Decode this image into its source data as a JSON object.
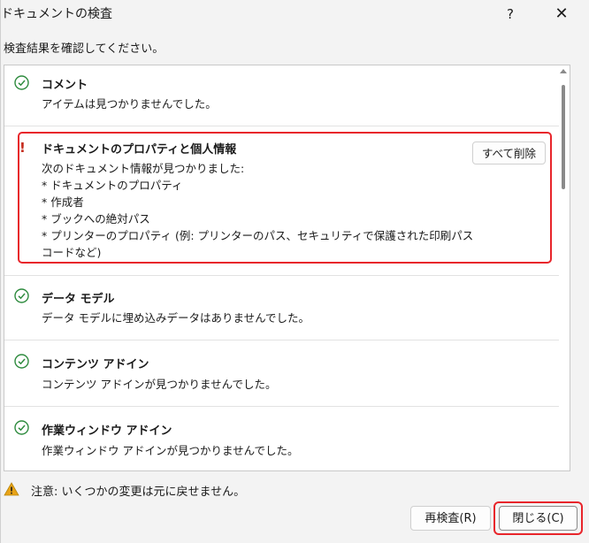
{
  "window": {
    "title": "ドキュメントの検査",
    "help_label": "?",
    "close_label": "✕"
  },
  "instruction": "検査結果を確認してください。",
  "sections": [
    {
      "title": "コメント",
      "status": "ok",
      "description": "アイテムは見つかりませんでした。"
    },
    {
      "title": "ドキュメントのプロパティと個人情報",
      "status": "found",
      "description": "次のドキュメント情報が見つかりました:\n* ドキュメントのプロパティ\n* 作成者\n* ブックへの絶対パス\n* プリンターのプロパティ (例: プリンターのパス、セキュリティで保護された印刷パス\nコードなど)",
      "action_label": "すべて削除"
    },
    {
      "title": "データ モデル",
      "status": "ok",
      "description": "データ モデルに埋め込みデータはありませんでした。"
    },
    {
      "title": "コンテンツ アドイン",
      "status": "ok",
      "description": "コンテンツ アドインが見つかりませんでした。"
    },
    {
      "title": "作業ウィンドウ アドイン",
      "status": "ok",
      "description": "作業ウィンドウ アドインが見つかりませんでした。"
    }
  ],
  "footer": {
    "note": "注意: いくつかの変更は元に戻せません。",
    "recheck_label": "再検査(R)",
    "close_label": "閉じる(C)"
  },
  "colors": {
    "check": "#2e8b3e",
    "alert": "#c42b1c",
    "highlight": "#e8252b",
    "warning_icon": "#e8a317"
  },
  "icons": {
    "ok": "check-circle-icon",
    "found": "exclamation-icon",
    "note": "warning-triangle-icon"
  }
}
